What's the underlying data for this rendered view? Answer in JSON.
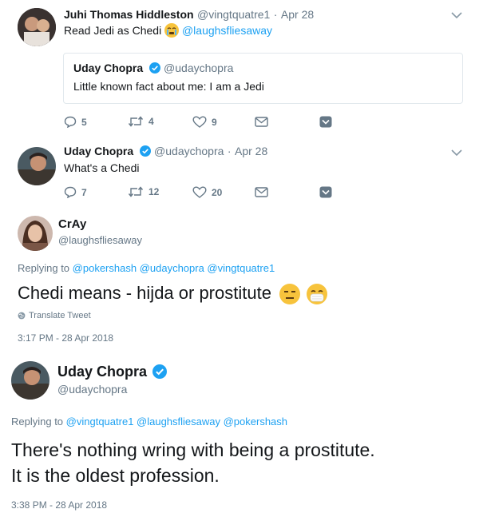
{
  "tweet1": {
    "name": "Juhi Thomas Hiddleston",
    "handle": "@vingtquatre1",
    "sep": "·",
    "date": "Apr 28",
    "text": "Read Jedi as Chedi",
    "mention": "@laughsfliesaway",
    "quote": {
      "name": "Uday Chopra",
      "handle": "@udaychopra",
      "text": "Little known fact about me: I am a Jedi"
    },
    "actions": {
      "replies": "5",
      "retweets": "4",
      "likes": "9"
    }
  },
  "tweet2": {
    "name": "Uday Chopra",
    "handle": "@udaychopra",
    "sep": "·",
    "date": "Apr 28",
    "text": "What's a Chedi",
    "actions": {
      "replies": "7",
      "retweets": "12",
      "likes": "20"
    }
  },
  "tweet3": {
    "name": "CrAy",
    "handle": "@laughsfliesaway",
    "replying_prefix": "Replying to",
    "replying_to": "@pokershash @udaychopra @vingtquatre1",
    "text": "Chedi means - hijda or prostitute",
    "translate": "Translate Tweet",
    "timestamp": "3:17 PM - 28 Apr 2018"
  },
  "tweet4": {
    "name": "Uday Chopra",
    "handle": "@udaychopra",
    "replying_prefix": "Replying to",
    "replying_to": "@vingtquatre1 @laughsfliesaway @pokershash",
    "text_line1": "There's nothing wring with being a prostitute.",
    "text_line2": "It is the oldest profession.",
    "timestamp": "3:38 PM - 28 Apr 2018"
  },
  "colors": {
    "accent": "#1da1f2",
    "muted": "#657786",
    "text": "#14171a"
  },
  "icons": [
    "reply-icon",
    "retweet-icon",
    "like-icon",
    "dm-icon",
    "caret-icon",
    "chevron-down-icon",
    "verified-badge-icon",
    "globe-icon"
  ]
}
